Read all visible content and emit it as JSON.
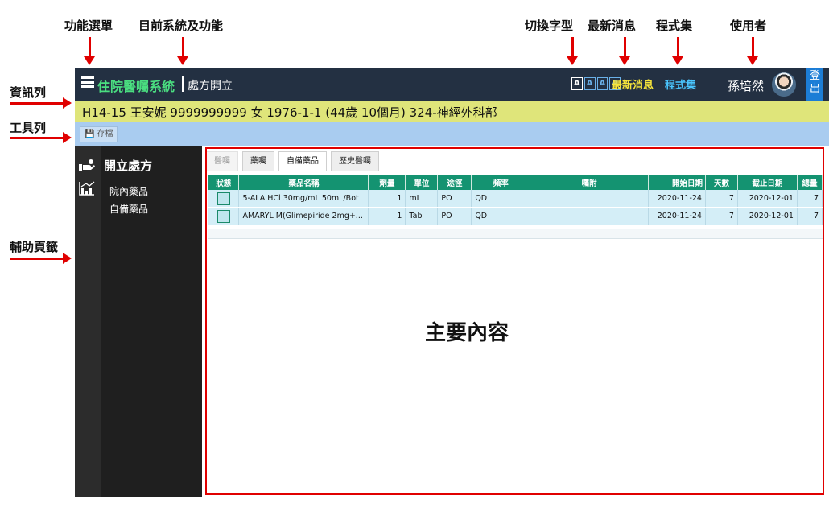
{
  "annotations": {
    "menu": "功能選單",
    "system_function": "目前系統及功能",
    "font_switch": "切換字型",
    "news": "最新消息",
    "programs": "程式集",
    "user": "使用者",
    "info_bar": "資訊列",
    "toolbar": "工具列",
    "aux_tabs": "輔助頁籤",
    "main_content": "主要內容"
  },
  "header": {
    "system_name": "住院醫囑系統",
    "function_name": "處方開立",
    "font_sizes": [
      "A",
      "A",
      "A",
      "A"
    ],
    "news_label": "最新消息",
    "programs_label": "程式集",
    "user_name": "孫培然",
    "logout_label": "登出"
  },
  "infobar": {
    "patient": "H14-15 王安妮 9999999999 女 1976-1-1 (44歲 10個月) 324-神經外科部"
  },
  "toolbar": {
    "save_label": "存檔"
  },
  "sidebar": {
    "title": "開立處方",
    "items": [
      {
        "label": "院內藥品"
      },
      {
        "label": "自備藥品"
      }
    ]
  },
  "tabs": [
    {
      "label": "醫囑",
      "state": "disabled"
    },
    {
      "label": "藥囑",
      "state": "normal"
    },
    {
      "label": "自備藥品",
      "state": "active"
    },
    {
      "label": "歷史醫囑",
      "state": "normal"
    }
  ],
  "table": {
    "headers": [
      "狀態",
      "藥品名稱",
      "劑量",
      "單位",
      "途徑",
      "頻率",
      "囑附",
      "開始日期",
      "天數",
      "截止日期",
      "總量"
    ],
    "rows": [
      {
        "name": "5-ALA HCl 30mg/mL 50mL/Bot",
        "dose": "1",
        "unit": "mL",
        "route": "PO",
        "freq": "QD",
        "note": "",
        "start": "2020-11-24",
        "days": "7",
        "end": "2020-12-01",
        "total": "7"
      },
      {
        "name": "AMARYL M(Glimepiride 2mg+...",
        "dose": "1",
        "unit": "Tab",
        "route": "PO",
        "freq": "QD",
        "note": "",
        "start": "2020-11-24",
        "days": "7",
        "end": "2020-12-01",
        "total": "7"
      }
    ]
  },
  "colors": {
    "header_bg": "#233042",
    "system_name": "#4ade80",
    "news": "#f7e53b",
    "programs": "#4ac6ff",
    "infobar_bg": "#dfe57a",
    "toolbar_bg": "#a9ccf0",
    "table_header": "#149371",
    "table_row": "#d4eef7",
    "annotation_red": "#e00000"
  },
  "icons": {
    "menu": "hamburger-icon",
    "save": "floppy-disk-icon",
    "sidebar_prescribe": "hand-pill-icon",
    "sidebar_chart": "bar-chart-icon",
    "avatar": "user-avatar"
  }
}
